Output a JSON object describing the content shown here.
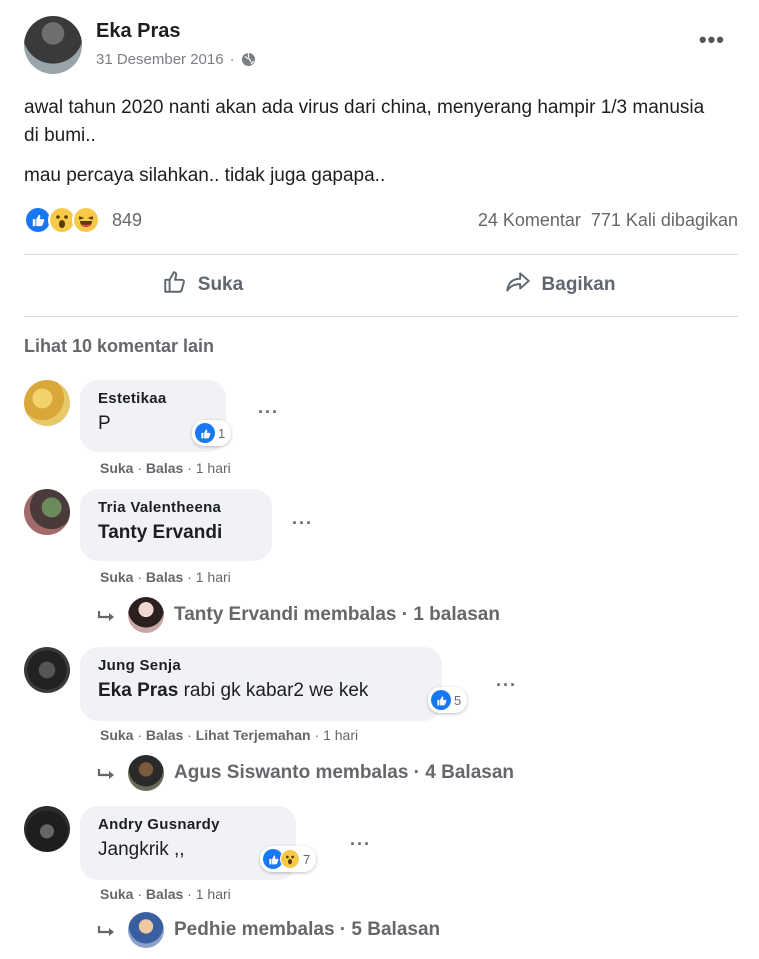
{
  "post": {
    "author": "Eka Pras",
    "date": "31 Desember 2016",
    "dot": "·",
    "paragraphs": [
      "awal tahun 2020 nanti akan ada virus dari china, menyerang hampir 1/3 manusia di bumi..",
      "mau percaya silahkan.. tidak juga gapapa.."
    ],
    "more_label": "•••",
    "reaction_count": "849",
    "comments_count": "24 Komentar",
    "shares_count": "771 Kali dibagikan"
  },
  "actions": {
    "like": "Suka",
    "share": "Bagikan"
  },
  "more_comments_label": "Lihat 10 komentar lain",
  "comments": [
    {
      "name": "Estetikaa",
      "text": "P",
      "reaction_count": "1",
      "actions": {
        "like": "Suka",
        "reply": "Balas",
        "time": "1 hari"
      }
    },
    {
      "name": "Tria Valentheena",
      "text": "Tanty Ervandi",
      "actions": {
        "like": "Suka",
        "reply": "Balas",
        "time": "1 hari"
      },
      "reply": "Tanty Ervandi membalas · 1 balasan"
    },
    {
      "name": "Jung Senja",
      "tag": "Eka Pras",
      "text": " rabi gk kabar2 we kek",
      "reaction_count": "5",
      "actions": {
        "like": "Suka",
        "reply": "Balas",
        "translate": "Lihat Terjemahan",
        "time": "1 hari"
      },
      "reply": "Agus Siswanto membalas · 4 Balasan"
    },
    {
      "name": "Andry Gusnardy",
      "text": "Jangkrik ,,",
      "reaction_count": "7",
      "actions": {
        "like": "Suka",
        "reply": "Balas",
        "time": "1 hari"
      },
      "reply": "Pedhie membalas · 5 Balasan"
    }
  ],
  "colors": {
    "like_blue": "#1877f2",
    "wow_yellow": "#f7c948",
    "meta_gray": "#65676b"
  },
  "icons": [
    "globe-icon",
    "like-icon",
    "wow-icon",
    "haha-icon",
    "thumbs-up-icon",
    "share-arrow-icon",
    "reply-arrow-icon"
  ]
}
